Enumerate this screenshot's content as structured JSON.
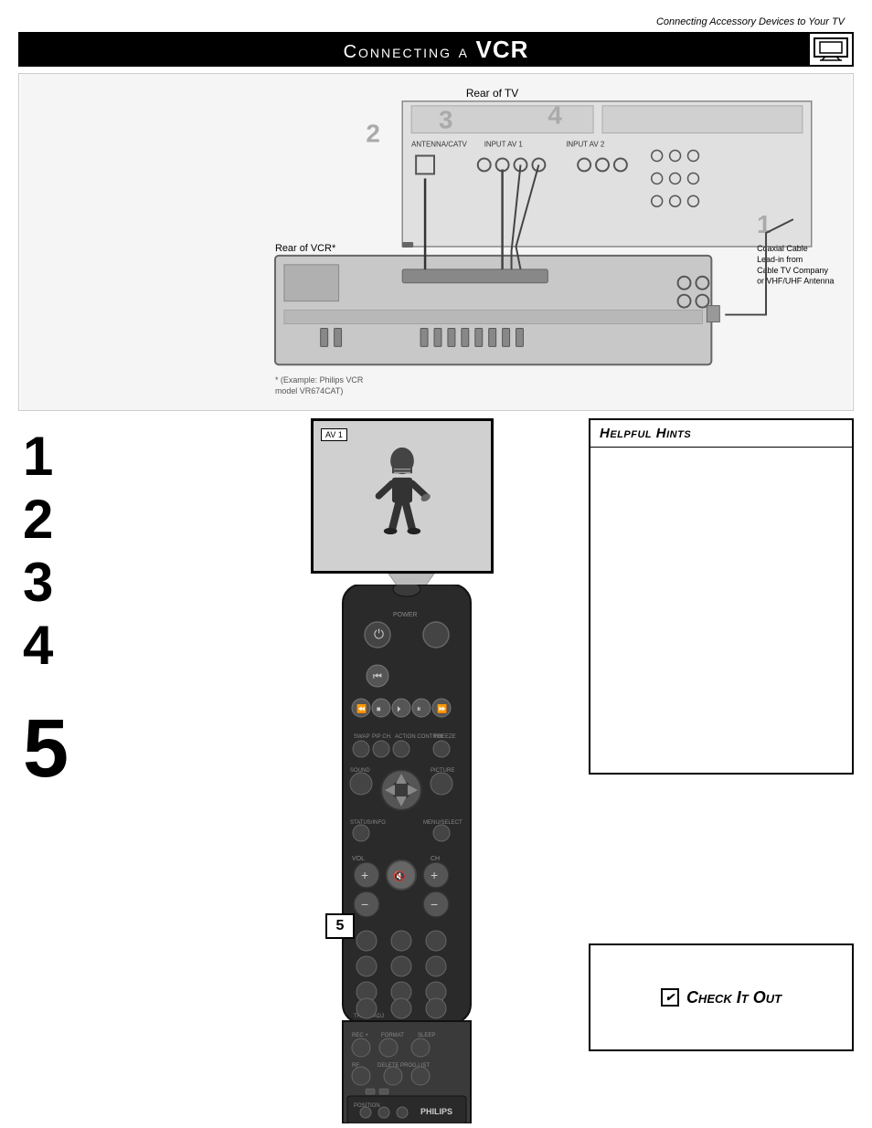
{
  "page": {
    "subtitle": "Connecting Accessory Devices to Your TV",
    "title_prefix": "Connecting a ",
    "title_suffix": "VCR",
    "footnote": "* (Example: Philips VCR model VR674CAT)"
  },
  "diagram": {
    "labels": {
      "rear_tv": "Rear of TV",
      "rear_vcr": "Rear of VCR*",
      "coaxial_cable": "Coaxial Cable\nLead-in from\nCable TV Company\nor VHF/UHF Antenna",
      "step2": "2",
      "step3": "3",
      "step4": "4",
      "step1": "1"
    }
  },
  "steps": {
    "numbers": [
      "1",
      "2",
      "3",
      "4"
    ],
    "number5": "5"
  },
  "tv_preview": {
    "av_label": "AV 1"
  },
  "helpful_hints": {
    "title": "Helpful Hints",
    "content": ""
  },
  "check_it_out": {
    "title": "Check It Out",
    "checkbox_symbol": "✔"
  },
  "icons": {
    "title_bar_icon": "tv-connections-icon"
  }
}
